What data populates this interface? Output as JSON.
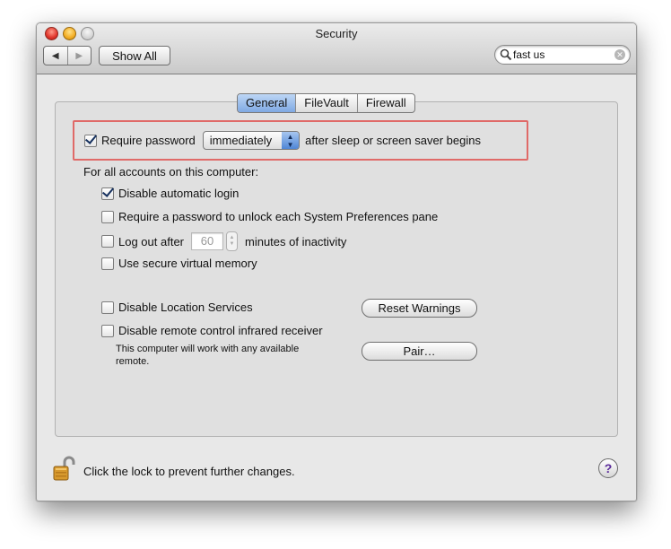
{
  "window": {
    "title": "Security"
  },
  "toolbar": {
    "back_glyph": "◀",
    "forward_glyph": "▶",
    "show_all_label": "Show All"
  },
  "search": {
    "value": "fast us",
    "clear_glyph": "✕"
  },
  "tabs": [
    {
      "label": "General",
      "active": true
    },
    {
      "label": "FileVault",
      "active": false
    },
    {
      "label": "Firewall",
      "active": false
    }
  ],
  "require_password": {
    "checked": true,
    "label": "Require password",
    "popup_value": "immediately",
    "suffix": "after sleep or screen saver begins"
  },
  "accounts": {
    "heading": "For all accounts on this computer:",
    "disable_auto_login": {
      "label": "Disable automatic login",
      "checked": true
    },
    "require_unlock_prefs": {
      "label": "Require a password to unlock each System Preferences pane",
      "checked": false
    },
    "logout": {
      "label": "Log out after",
      "minutes": "60",
      "suffix": "minutes of inactivity",
      "checked": false
    },
    "secure_vm": {
      "label": "Use secure virtual memory",
      "checked": false
    }
  },
  "location": {
    "label": "Disable Location Services",
    "checked": false,
    "button": "Reset Warnings"
  },
  "infrared": {
    "label": "Disable remote control infrared receiver",
    "checked": false,
    "note_line1": "This computer will work with any available",
    "note_line2": "remote.",
    "button": "Pair…"
  },
  "footer": {
    "lock_text": "Click the lock to prevent further changes.",
    "help_glyph": "?"
  },
  "icons": [
    "close-light",
    "minimize-light",
    "zoom-light",
    "back-arrow",
    "forward-arrow",
    "magnifier-icon",
    "clear-icon",
    "popup-arrows",
    "stepper-arrows",
    "unlocked-padlock-icon",
    "help-icon"
  ]
}
